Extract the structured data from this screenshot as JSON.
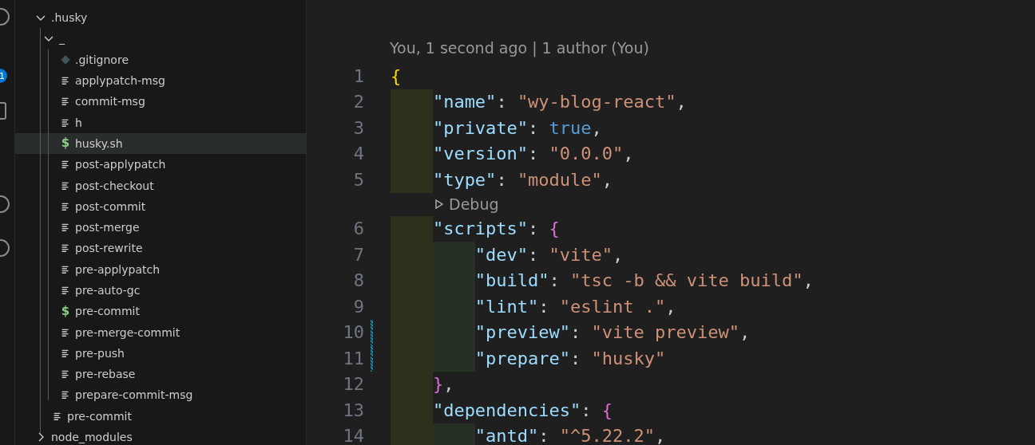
{
  "activity_bar": {
    "badge": "1"
  },
  "explorer": {
    "items": [
      {
        "label": ".husky",
        "kind": "folder",
        "expanded": true,
        "selected": false,
        "children": [
          {
            "label": "_",
            "kind": "folder",
            "expanded": true,
            "selected": false,
            "children": [
              {
                "label": ".gitignore",
                "kind": "git",
                "selected": false
              },
              {
                "label": "applypatch-msg",
                "kind": "text",
                "selected": false
              },
              {
                "label": "commit-msg",
                "kind": "text",
                "selected": false
              },
              {
                "label": "h",
                "kind": "text",
                "selected": false
              },
              {
                "label": "husky.sh",
                "kind": "shell",
                "icon": "$",
                "selected": true
              },
              {
                "label": "post-applypatch",
                "kind": "text",
                "selected": false
              },
              {
                "label": "post-checkout",
                "kind": "text",
                "selected": false
              },
              {
                "label": "post-commit",
                "kind": "text",
                "selected": false
              },
              {
                "label": "post-merge",
                "kind": "text",
                "selected": false
              },
              {
                "label": "post-rewrite",
                "kind": "text",
                "selected": false
              },
              {
                "label": "pre-applypatch",
                "kind": "text",
                "selected": false
              },
              {
                "label": "pre-auto-gc",
                "kind": "text",
                "selected": false
              },
              {
                "label": "pre-commit",
                "kind": "shell",
                "icon": "$",
                "selected": false
              },
              {
                "label": "pre-merge-commit",
                "kind": "text",
                "selected": false
              },
              {
                "label": "pre-push",
                "kind": "text",
                "selected": false
              },
              {
                "label": "pre-rebase",
                "kind": "text",
                "selected": false
              },
              {
                "label": "prepare-commit-msg",
                "kind": "text",
                "selected": false
              }
            ]
          },
          {
            "label": "pre-commit",
            "kind": "text",
            "selected": false
          }
        ]
      },
      {
        "label": "node_modules",
        "kind": "folder",
        "expanded": false,
        "selected": false
      }
    ]
  },
  "editor": {
    "blame": "You, 1 second ago | 1 author (You)",
    "lines": [
      {
        "kind": "code",
        "number": "1",
        "modified": false,
        "tokens": [
          {
            "kind": "bracket",
            "text": "{",
            "color": "#ffd700"
          }
        ]
      },
      {
        "kind": "code",
        "number": "2",
        "modified": false,
        "tokens": [
          {
            "kind": "key",
            "text": "\"name\""
          },
          {
            "kind": "punct",
            "text": ": "
          },
          {
            "kind": "string",
            "text": "\"wy-blog-react\""
          },
          {
            "kind": "punct",
            "text": ","
          }
        ]
      },
      {
        "kind": "code",
        "number": "3",
        "modified": false,
        "tokens": [
          {
            "kind": "key",
            "text": "\"private\""
          },
          {
            "kind": "punct",
            "text": ": "
          },
          {
            "kind": "bool",
            "text": "true"
          },
          {
            "kind": "punct",
            "text": ","
          }
        ]
      },
      {
        "kind": "code",
        "number": "4",
        "modified": false,
        "tokens": [
          {
            "kind": "key",
            "text": "\"version\""
          },
          {
            "kind": "punct",
            "text": ": "
          },
          {
            "kind": "string",
            "text": "\"0.0.0\""
          },
          {
            "kind": "punct",
            "text": ","
          }
        ]
      },
      {
        "kind": "code",
        "number": "5",
        "modified": false,
        "tokens": [
          {
            "kind": "key",
            "text": "\"type\""
          },
          {
            "kind": "punct",
            "text": ": "
          },
          {
            "kind": "string",
            "text": "\"module\""
          },
          {
            "kind": "punct",
            "text": ","
          }
        ]
      },
      {
        "kind": "lens",
        "label": "Debug"
      },
      {
        "kind": "code",
        "number": "6",
        "modified": false,
        "tokens": [
          {
            "kind": "key",
            "text": "\"scripts\""
          },
          {
            "kind": "punct",
            "text": ": "
          },
          {
            "kind": "bracket",
            "text": "{",
            "color": "#da70d6"
          }
        ]
      },
      {
        "kind": "code",
        "number": "7",
        "modified": false,
        "tokens": [
          {
            "kind": "key",
            "text": "\"dev\""
          },
          {
            "kind": "punct",
            "text": ": "
          },
          {
            "kind": "string",
            "text": "\"vite\""
          },
          {
            "kind": "punct",
            "text": ","
          }
        ]
      },
      {
        "kind": "code",
        "number": "8",
        "modified": false,
        "tokens": [
          {
            "kind": "key",
            "text": "\"build\""
          },
          {
            "kind": "punct",
            "text": ": "
          },
          {
            "kind": "string",
            "text": "\"tsc -b && vite build\""
          },
          {
            "kind": "punct",
            "text": ","
          }
        ]
      },
      {
        "kind": "code",
        "number": "9",
        "modified": false,
        "tokens": [
          {
            "kind": "key",
            "text": "\"lint\""
          },
          {
            "kind": "punct",
            "text": ": "
          },
          {
            "kind": "string",
            "text": "\"eslint .\""
          },
          {
            "kind": "punct",
            "text": ","
          }
        ]
      },
      {
        "kind": "code",
        "number": "10",
        "modified": true,
        "tokens": [
          {
            "kind": "key",
            "text": "\"preview\""
          },
          {
            "kind": "punct",
            "text": ": "
          },
          {
            "kind": "string",
            "text": "\"vite preview\""
          },
          {
            "kind": "punct",
            "text": ","
          }
        ]
      },
      {
        "kind": "code",
        "number": "11",
        "modified": true,
        "tokens": [
          {
            "kind": "key",
            "text": "\"prepare\""
          },
          {
            "kind": "punct",
            "text": ": "
          },
          {
            "kind": "string",
            "text": "\"husky\""
          }
        ]
      },
      {
        "kind": "code",
        "number": "12",
        "modified": false,
        "tokens": [
          {
            "kind": "bracket",
            "text": "}",
            "color": "#da70d6"
          },
          {
            "kind": "punct",
            "text": ","
          }
        ]
      },
      {
        "kind": "code",
        "number": "13",
        "modified": false,
        "tokens": [
          {
            "kind": "key",
            "text": "\"dependencies\""
          },
          {
            "kind": "punct",
            "text": ": "
          },
          {
            "kind": "bracket",
            "text": "{",
            "color": "#da70d6"
          }
        ]
      },
      {
        "kind": "code",
        "number": "14",
        "modified": false,
        "tokens": [
          {
            "kind": "key",
            "text": "\"antd\""
          },
          {
            "kind": "punct",
            "text": ": "
          },
          {
            "kind": "string",
            "text": "\"^5.22.2\""
          },
          {
            "kind": "punct",
            "text": ","
          }
        ]
      }
    ]
  }
}
